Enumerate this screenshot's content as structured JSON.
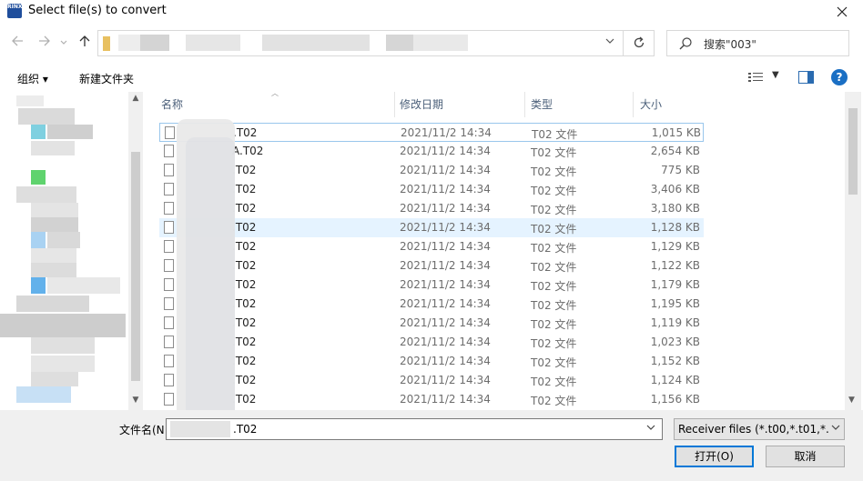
{
  "window": {
    "title": "Select file(s) to convert",
    "app_icon_text": "RINX"
  },
  "address": {
    "search_placeholder": "搜索\"003\""
  },
  "toolbar": {
    "organize_label": "组织 ▾",
    "new_folder_label": "新建文件夹"
  },
  "columns": {
    "name": "名称",
    "date": "修改日期",
    "type": "类型",
    "size": "大小"
  },
  "files": [
    {
      "name": ".T02",
      "date": "2021/11/2 14:34",
      "type": "T02 文件",
      "size": "1,015 KB"
    },
    {
      "name": "A.T02",
      "date": "2021/11/2 14:34",
      "type": "T02 文件",
      "size": "2,654 KB"
    },
    {
      "name": ".T02",
      "date": "2021/11/2 14:34",
      "type": "T02 文件",
      "size": "775 KB"
    },
    {
      "name": ".T02",
      "date": "2021/11/2 14:34",
      "type": "T02 文件",
      "size": "3,406 KB"
    },
    {
      "name": ".T02",
      "date": "2021/11/2 14:34",
      "type": "T02 文件",
      "size": "3,180 KB"
    },
    {
      "name": ".T02",
      "date": "2021/11/2 14:34",
      "type": "T02 文件",
      "size": "1,128 KB"
    },
    {
      "name": ".T02",
      "date": "2021/11/2 14:34",
      "type": "T02 文件",
      "size": "1,129 KB"
    },
    {
      "name": ".T02",
      "date": "2021/11/2 14:34",
      "type": "T02 文件",
      "size": "1,122 KB"
    },
    {
      "name": ".T02",
      "date": "2021/11/2 14:34",
      "type": "T02 文件",
      "size": "1,179 KB"
    },
    {
      "name": ".T02",
      "date": "2021/11/2 14:34",
      "type": "T02 文件",
      "size": "1,195 KB"
    },
    {
      "name": ".T02",
      "date": "2021/11/2 14:34",
      "type": "T02 文件",
      "size": "1,119 KB"
    },
    {
      "name": ".T02",
      "date": "2021/11/2 14:34",
      "type": "T02 文件",
      "size": "1,023 KB"
    },
    {
      "name": ".T02",
      "date": "2021/11/2 14:34",
      "type": "T02 文件",
      "size": "1,152 KB"
    },
    {
      "name": ".T02",
      "date": "2021/11/2 14:34",
      "type": "T02 文件",
      "size": "1,124 KB"
    },
    {
      "name": ".T02",
      "date": "2021/11/2 14:34",
      "type": "T02 文件",
      "size": "1,156 KB"
    }
  ],
  "bottom": {
    "filename_label": "文件名(N",
    "filename_value": ".T02",
    "filter_value": "Receiver files (*.t00,*.t01,*.t02",
    "open_label": "打开(O)",
    "cancel_label": "取消"
  },
  "colors": {
    "accent": "#0078d7",
    "selection": "#e5f3ff",
    "focus_border": "#99c6ec",
    "help": "#1a6fc4"
  }
}
